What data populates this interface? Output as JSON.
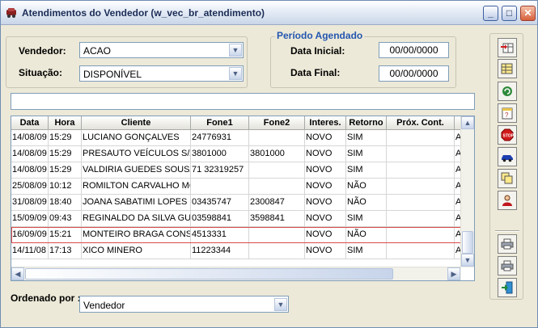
{
  "window": {
    "title": "Atendimentos do Vendedor (w_vec_br_atendimento)",
    "minimize": "_",
    "maximize": "□",
    "close": "✕"
  },
  "filters": {
    "vendedor_label": "Vendedor:",
    "vendedor_value": "ACAO",
    "situacao_label": "Situação:",
    "situacao_value": "DISPONÍVEL"
  },
  "periodo": {
    "group_title": "Período Agendado",
    "data_inicial_label": "Data Inicial:",
    "data_inicial_value": "00/00/0000",
    "data_final_label": "Data Final:",
    "data_final_value": "00/00/0000"
  },
  "info_bar": "",
  "grid": {
    "columns": [
      "Data",
      "Hora",
      "Cliente",
      "Fone1",
      "Fone2",
      "Interes.",
      "Retorno",
      "Próx. Cont."
    ],
    "rows": [
      [
        "14/08/09",
        "15:29",
        "LUCIANO GONÇALVES",
        "24776931",
        "",
        "NOVO",
        "SIM",
        "",
        "A"
      ],
      [
        "14/08/09",
        "15:29",
        "PRESAUTO VEÍCULOS S/A",
        "3801000",
        "3801000",
        "NOVO",
        "SIM",
        "",
        "A"
      ],
      [
        "14/08/09",
        "15:29",
        "VALDIRIA GUEDES SOUSA",
        "71 32319257",
        "",
        "NOVO",
        "SIM",
        "",
        "A"
      ],
      [
        "25/08/09",
        "10:12",
        "ROMILTON CARVALHO MO",
        "",
        "",
        "NOVO",
        "NÃO",
        "",
        "A"
      ],
      [
        "31/08/09",
        "18:40",
        "JOANA SABATIMI LOPES",
        "03435747",
        "2300847",
        "NOVO",
        "NÃO",
        "",
        "A"
      ],
      [
        "15/09/09",
        "09:43",
        "REGINALDO DA SILVA GUI",
        "03598841",
        "3598841",
        "NOVO",
        "SIM",
        "",
        "A"
      ],
      [
        "16/09/09",
        "15:21",
        "MONTEIRO BRAGA CONSU",
        "4513331",
        "",
        "NOVO",
        "NÃO",
        "",
        "A"
      ],
      [
        "14/11/08",
        "17:13",
        "XICO MINERO",
        "11223344",
        "",
        "NOVO",
        "SIM",
        "",
        "A"
      ]
    ],
    "selected_row": 6
  },
  "order": {
    "label": "Ordenado por :",
    "value": "Vendedor"
  },
  "toolbar_icons": [
    "add-row-icon",
    "grid-edit-icon",
    "refresh-icon",
    "calendar-icon",
    "stop-icon",
    "car-icon",
    "copy-icon",
    "user-icon",
    "print-icon",
    "print-preview-icon",
    "exit-icon"
  ],
  "colors": {
    "selected_row_border": "#d94a4a",
    "group_title": "#2456b0"
  }
}
